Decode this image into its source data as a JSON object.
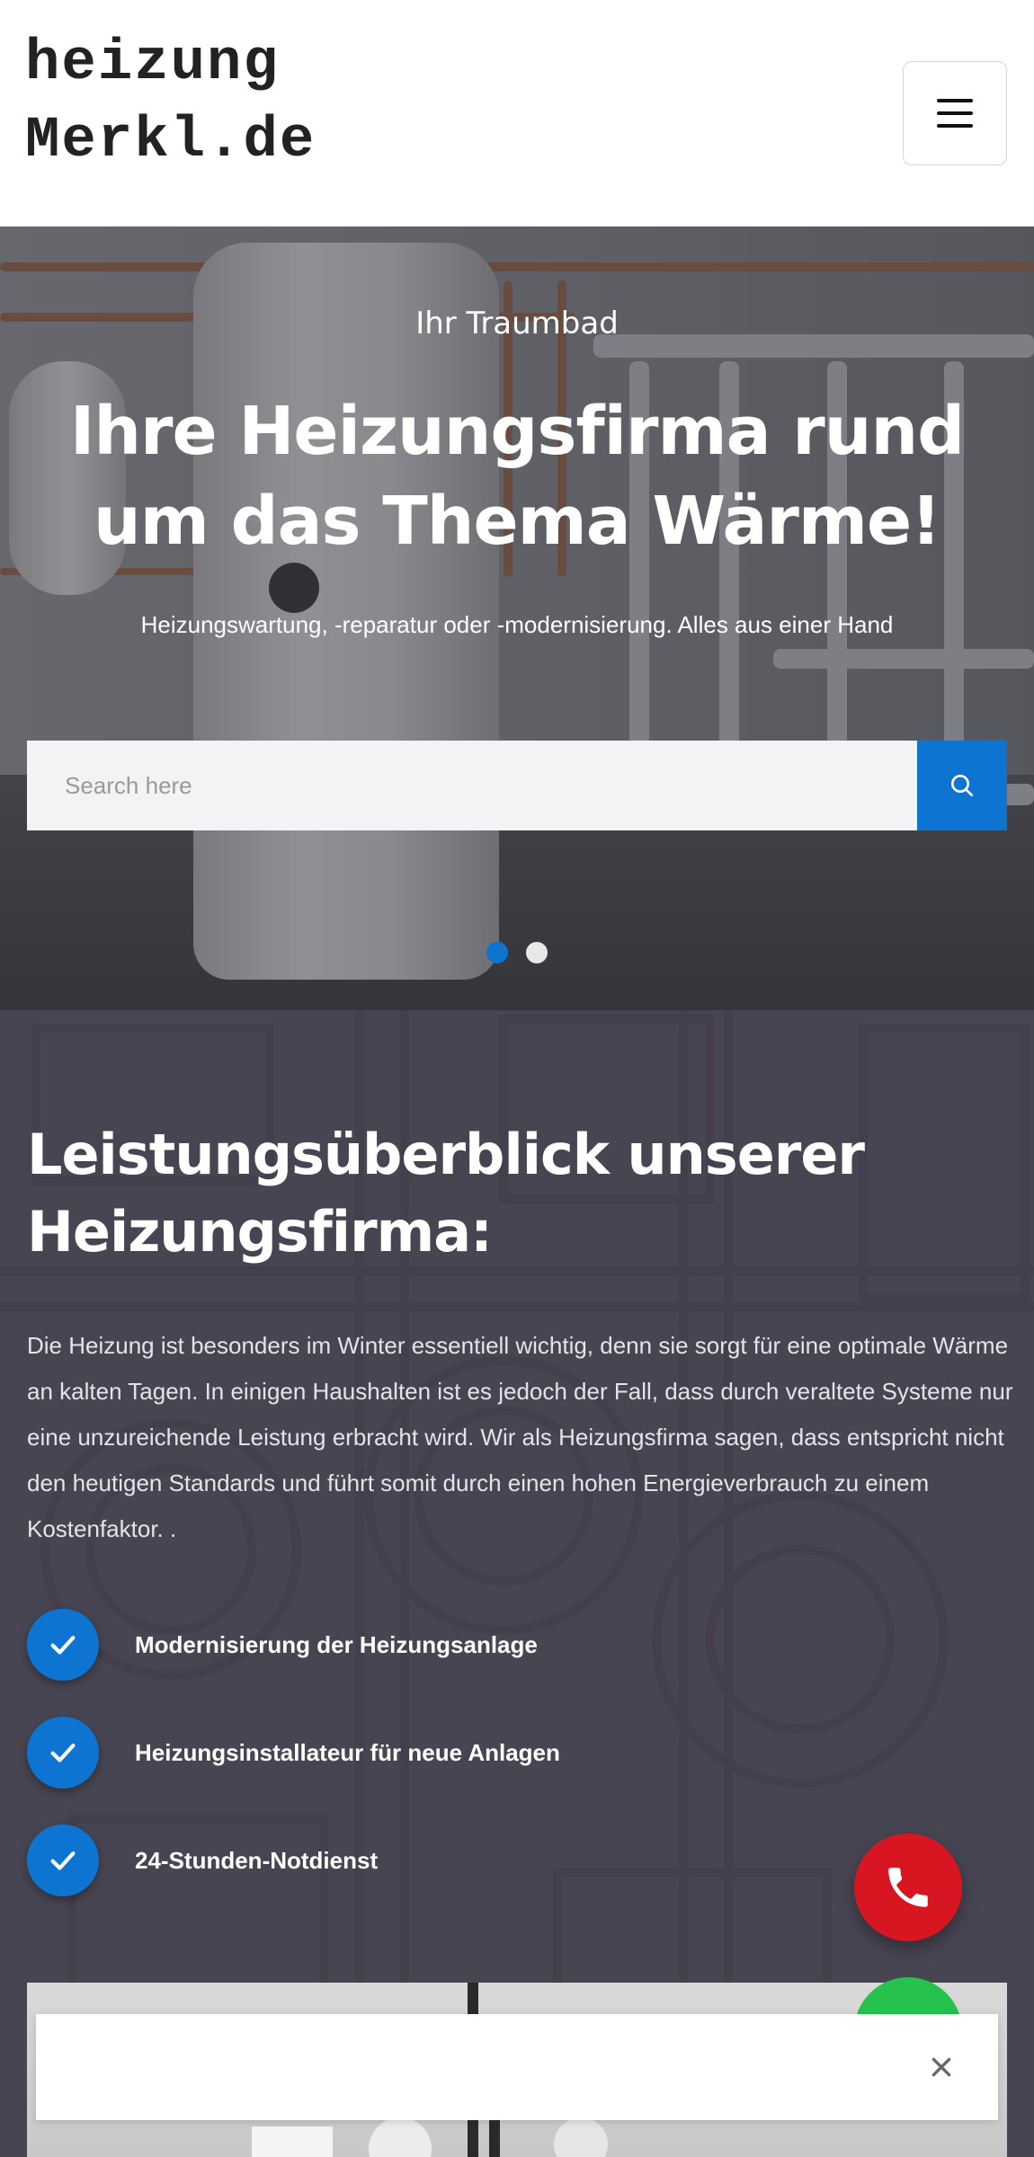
{
  "header": {
    "logo_line1": "heizung",
    "logo_line2": "Merkl.de",
    "menu_icon": "hamburger-menu-icon"
  },
  "hero": {
    "subtitle": "Ihr Traumbad",
    "title": "Ihre Heizungsfirma rund um das Thema Wärme!",
    "description": "Heizungswartung, -reparatur oder -modernisierung. Alles aus einer Hand",
    "search": {
      "placeholder": "Search here",
      "value": "",
      "icon": "search-icon"
    },
    "slides": {
      "count": 2,
      "active_index": 0
    }
  },
  "services": {
    "title": "Leistungsüberblick unserer Heizungsfirma:",
    "body": "Die Heizung ist besonders im Winter essentiell wichtig, denn sie sorgt für eine optimale Wärme an kalten Tagen. In einigen Haushalten ist es jedoch der Fall, dass durch veraltete Systeme nur eine unzureichende Leistung erbracht wird. Wir als Heizungsfirma sagen, dass entspricht nicht den heutigen Standards und führt somit durch einen hohen Energieverbrauch zu einem Kostenfaktor. .",
    "features": [
      {
        "label": "Modernisierung der Heizungsanlage",
        "icon": "checkmark-icon"
      },
      {
        "label": "Heizungsinstallateur für neue Anlagen",
        "icon": "checkmark-icon"
      },
      {
        "label": "24-Stunden-Notdienst",
        "icon": "checkmark-icon"
      }
    ]
  },
  "floating": {
    "call_icon": "phone-icon",
    "chat_icon": "whatsapp-icon",
    "close_icon": "close-icon"
  },
  "colors": {
    "accent": "#0d74d1",
    "call": "#d81621",
    "whatsapp": "#25c24e"
  }
}
